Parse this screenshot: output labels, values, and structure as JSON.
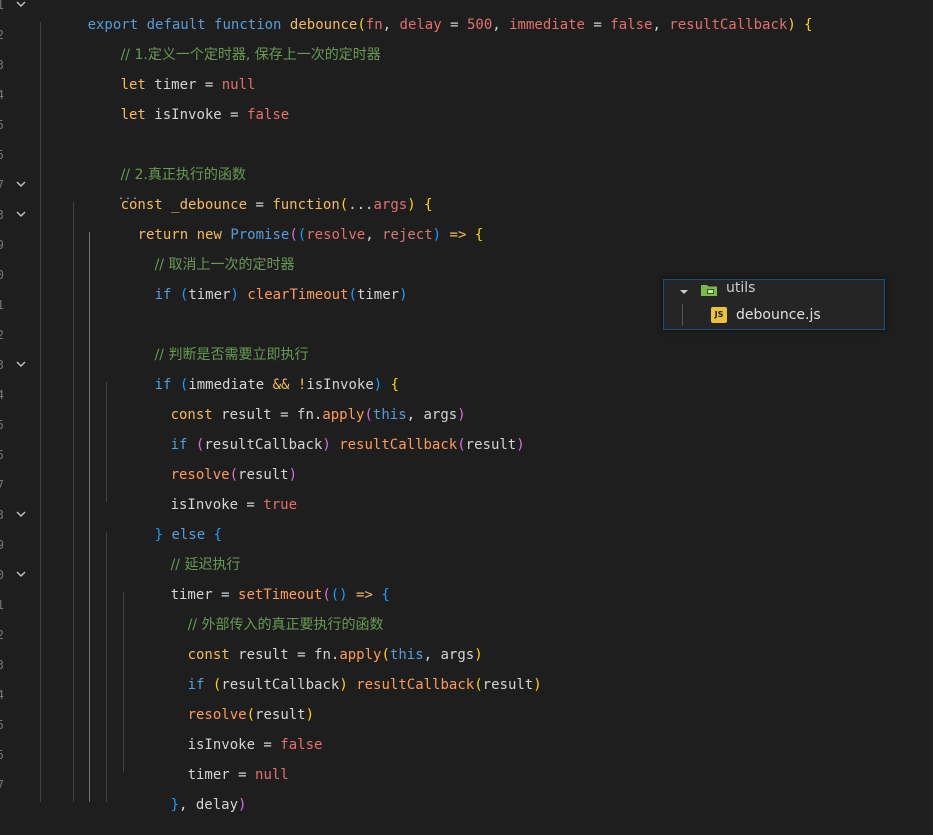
{
  "theme": {
    "background": "#1e1e1e",
    "keyword": "#569cd6",
    "function": "#f2bc59",
    "comment": "#6a9955",
    "literal": "#e56f6f"
  },
  "explorer": {
    "folder_label": "utils",
    "file_label": "debounce.js",
    "file_icon_text": "JS"
  },
  "gutter": {
    "line_number_tails": [
      "1",
      "2",
      "3",
      "4",
      "5",
      "5",
      "7",
      "3",
      "9",
      "0",
      "1",
      "2",
      "3",
      "4",
      "5",
      "5",
      "7",
      "3",
      "9",
      "0",
      "1",
      "2",
      "3",
      "4",
      "5",
      "5",
      "7"
    ]
  },
  "code": {
    "l1": [
      "export",
      " ",
      "default",
      " ",
      "function",
      " ",
      "debounce",
      "(",
      "fn",
      ", ",
      "delay",
      " = ",
      "500",
      ", ",
      "immediate",
      " = ",
      "false",
      ", ",
      "resultCallback",
      ")",
      " {"
    ],
    "l2": "// 1.定义一个定时器, 保存上一次的定时器",
    "l3": [
      "let",
      " timer = ",
      "null"
    ],
    "l4": [
      "let",
      " isInvoke = ",
      "false"
    ],
    "l6": "// 2.真正执行的函数",
    "l7": [
      "const",
      " ",
      "_debounce",
      " = ",
      "function",
      "(",
      "...",
      "args",
      ")",
      " {"
    ],
    "l8": [
      "return",
      " ",
      "new",
      " ",
      "Promise",
      "(",
      "(",
      "resolve",
      ", ",
      "reject",
      ")",
      " => ",
      "{"
    ],
    "l9": "// 取消上一次的定时器",
    "l10": [
      "if",
      " ",
      "(",
      "timer",
      ")",
      " ",
      "clearTimeout",
      "(",
      "timer",
      ")"
    ],
    "l12": "// 判断是否需要立即执行",
    "l13": [
      "if",
      " ",
      "(",
      "immediate",
      " && ",
      "!",
      "isInvoke",
      ")",
      " {"
    ],
    "l14": [
      "const",
      " result = fn.",
      "apply",
      "(",
      "this",
      ", args",
      ")"
    ],
    "l15": [
      "if",
      " ",
      "(",
      "resultCallback",
      ")",
      " ",
      "resultCallback",
      "(",
      "result",
      ")"
    ],
    "l16": [
      "resolve",
      "(",
      "result",
      ")"
    ],
    "l17": [
      "isInvoke = ",
      "true"
    ],
    "l18": [
      "}",
      " ",
      "else",
      " {"
    ],
    "l19": "// 延迟执行",
    "l20": [
      "timer = ",
      "setTimeout",
      "(",
      "()",
      " => ",
      "{"
    ],
    "l21": "// 外部传入的真正要执行的函数",
    "l22": [
      "const",
      " result = fn.",
      "apply",
      "(",
      "this",
      ", args",
      ")"
    ],
    "l23": [
      "if",
      " ",
      "(",
      "resultCallback",
      ")",
      " ",
      "resultCallback",
      "(",
      "result",
      ")"
    ],
    "l24": [
      "resolve",
      "(",
      "result",
      ")"
    ],
    "l25": [
      "isInvoke = ",
      "false"
    ],
    "l26": [
      "timer = ",
      "null"
    ],
    "l27": [
      "}",
      ", delay",
      ")"
    ],
    "ellipsis": "..."
  }
}
